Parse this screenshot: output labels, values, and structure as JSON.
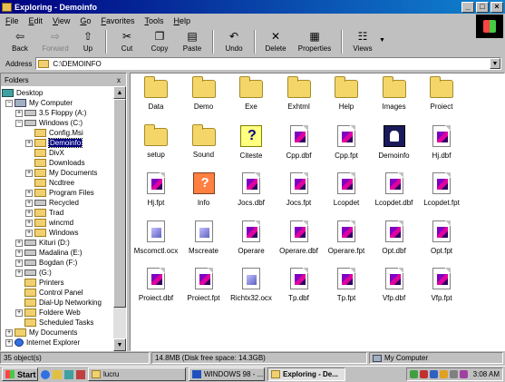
{
  "window": {
    "title": "Exploring - Demoinfo",
    "minimize": "_",
    "maximize": "□",
    "close": "×"
  },
  "menu": [
    "File",
    "Edit",
    "View",
    "Go",
    "Favorites",
    "Tools",
    "Help"
  ],
  "toolbar": {
    "back": "Back",
    "forward": "Forward",
    "up": "Up",
    "cut": "Cut",
    "copy": "Copy",
    "paste": "Paste",
    "undo": "Undo",
    "delete": "Delete",
    "properties": "Properties",
    "views": "Views"
  },
  "address": {
    "label": "Address",
    "value": "C:\\DEMOINFO"
  },
  "folders_pane": {
    "title": "Folders",
    "close": "x",
    "tree": [
      {
        "label": "Desktop"
      },
      {
        "label": "My Computer"
      },
      {
        "label": "3.5 Floppy (A:)"
      },
      {
        "label": "Windows (C:)"
      },
      {
        "label": "Config.Msi"
      },
      {
        "label": "Demoinfo"
      },
      {
        "label": "DivX"
      },
      {
        "label": "Downloads"
      },
      {
        "label": "My Documents"
      },
      {
        "label": "Ncdtree"
      },
      {
        "label": "Program Files"
      },
      {
        "label": "Recycled"
      },
      {
        "label": "Trad"
      },
      {
        "label": "wincmd"
      },
      {
        "label": "Windows"
      },
      {
        "label": "Kituri (D:)"
      },
      {
        "label": "Madalina (E:)"
      },
      {
        "label": "Bogdan (F:)"
      },
      {
        "label": "(G:)"
      },
      {
        "label": "Printers"
      },
      {
        "label": "Control Panel"
      },
      {
        "label": "Dial-Up Networking"
      },
      {
        "label": "Foldere Web"
      },
      {
        "label": "Scheduled Tasks"
      },
      {
        "label": "My Documents"
      },
      {
        "label": "Internet Explorer"
      }
    ]
  },
  "files": [
    {
      "name": "Data",
      "icon": "folder-icon"
    },
    {
      "name": "Demo",
      "icon": "folder-icon"
    },
    {
      "name": "Exe",
      "icon": "folder-icon"
    },
    {
      "name": "Exhtml",
      "icon": "folder-icon"
    },
    {
      "name": "Help",
      "icon": "folder-icon"
    },
    {
      "name": "Images",
      "icon": "folder-icon"
    },
    {
      "name": "Proiect",
      "icon": "folder-icon"
    },
    {
      "name": "setup",
      "icon": "folder-icon"
    },
    {
      "name": "Sound",
      "icon": "folder-icon"
    },
    {
      "name": "Citeste",
      "icon": "help-file-icon"
    },
    {
      "name": "Cpp.dbf",
      "icon": "foxpro-file-icon"
    },
    {
      "name": "Cpp.fpt",
      "icon": "foxpro-file-icon"
    },
    {
      "name": "Demoinfo",
      "icon": "application-icon"
    },
    {
      "name": "Hj.dbf",
      "icon": "foxpro-file-icon"
    },
    {
      "name": "Hj.fpt",
      "icon": "foxpro-file-icon"
    },
    {
      "name": "Info",
      "icon": "info-app-icon"
    },
    {
      "name": "Jocs.dbf",
      "icon": "foxpro-file-icon"
    },
    {
      "name": "Jocs.fpt",
      "icon": "foxpro-file-icon"
    },
    {
      "name": "Lcopdet",
      "icon": "foxpro-file-icon"
    },
    {
      "name": "Lcopdet.dbf",
      "icon": "foxpro-file-icon"
    },
    {
      "name": "Lcopdet.fpt",
      "icon": "foxpro-file-icon"
    },
    {
      "name": "Mscomctl.ocx",
      "icon": "ocx-file-icon"
    },
    {
      "name": "Mscreate",
      "icon": "ocx-file-icon"
    },
    {
      "name": "Operare",
      "icon": "foxpro-file-icon"
    },
    {
      "name": "Operare.dbf",
      "icon": "foxpro-file-icon"
    },
    {
      "name": "Operare.fpt",
      "icon": "foxpro-file-icon"
    },
    {
      "name": "Opt.dbf",
      "icon": "foxpro-file-icon"
    },
    {
      "name": "Opt.fpt",
      "icon": "foxpro-file-icon"
    },
    {
      "name": "Proiect.dbf",
      "icon": "foxpro-file-icon"
    },
    {
      "name": "Proiect.fpt",
      "icon": "foxpro-file-icon"
    },
    {
      "name": "Richtx32.ocx",
      "icon": "ocx-file-icon"
    },
    {
      "name": "Tp.dbf",
      "icon": "foxpro-file-icon"
    },
    {
      "name": "Tp.fpt",
      "icon": "foxpro-file-icon"
    },
    {
      "name": "Vfp.dbf",
      "icon": "foxpro-file-icon"
    },
    {
      "name": "Vfp.fpt",
      "icon": "foxpro-file-icon"
    }
  ],
  "status": {
    "count": "35 object(s)",
    "size": "14.8MB (Disk free space: 14.3GB)",
    "location": "My Computer"
  },
  "taskbar": {
    "start": "Start",
    "tasks": [
      "lucru",
      "WINDOWS 98 - ...",
      "Exploring - De..."
    ],
    "clock": "3:08 AM"
  }
}
